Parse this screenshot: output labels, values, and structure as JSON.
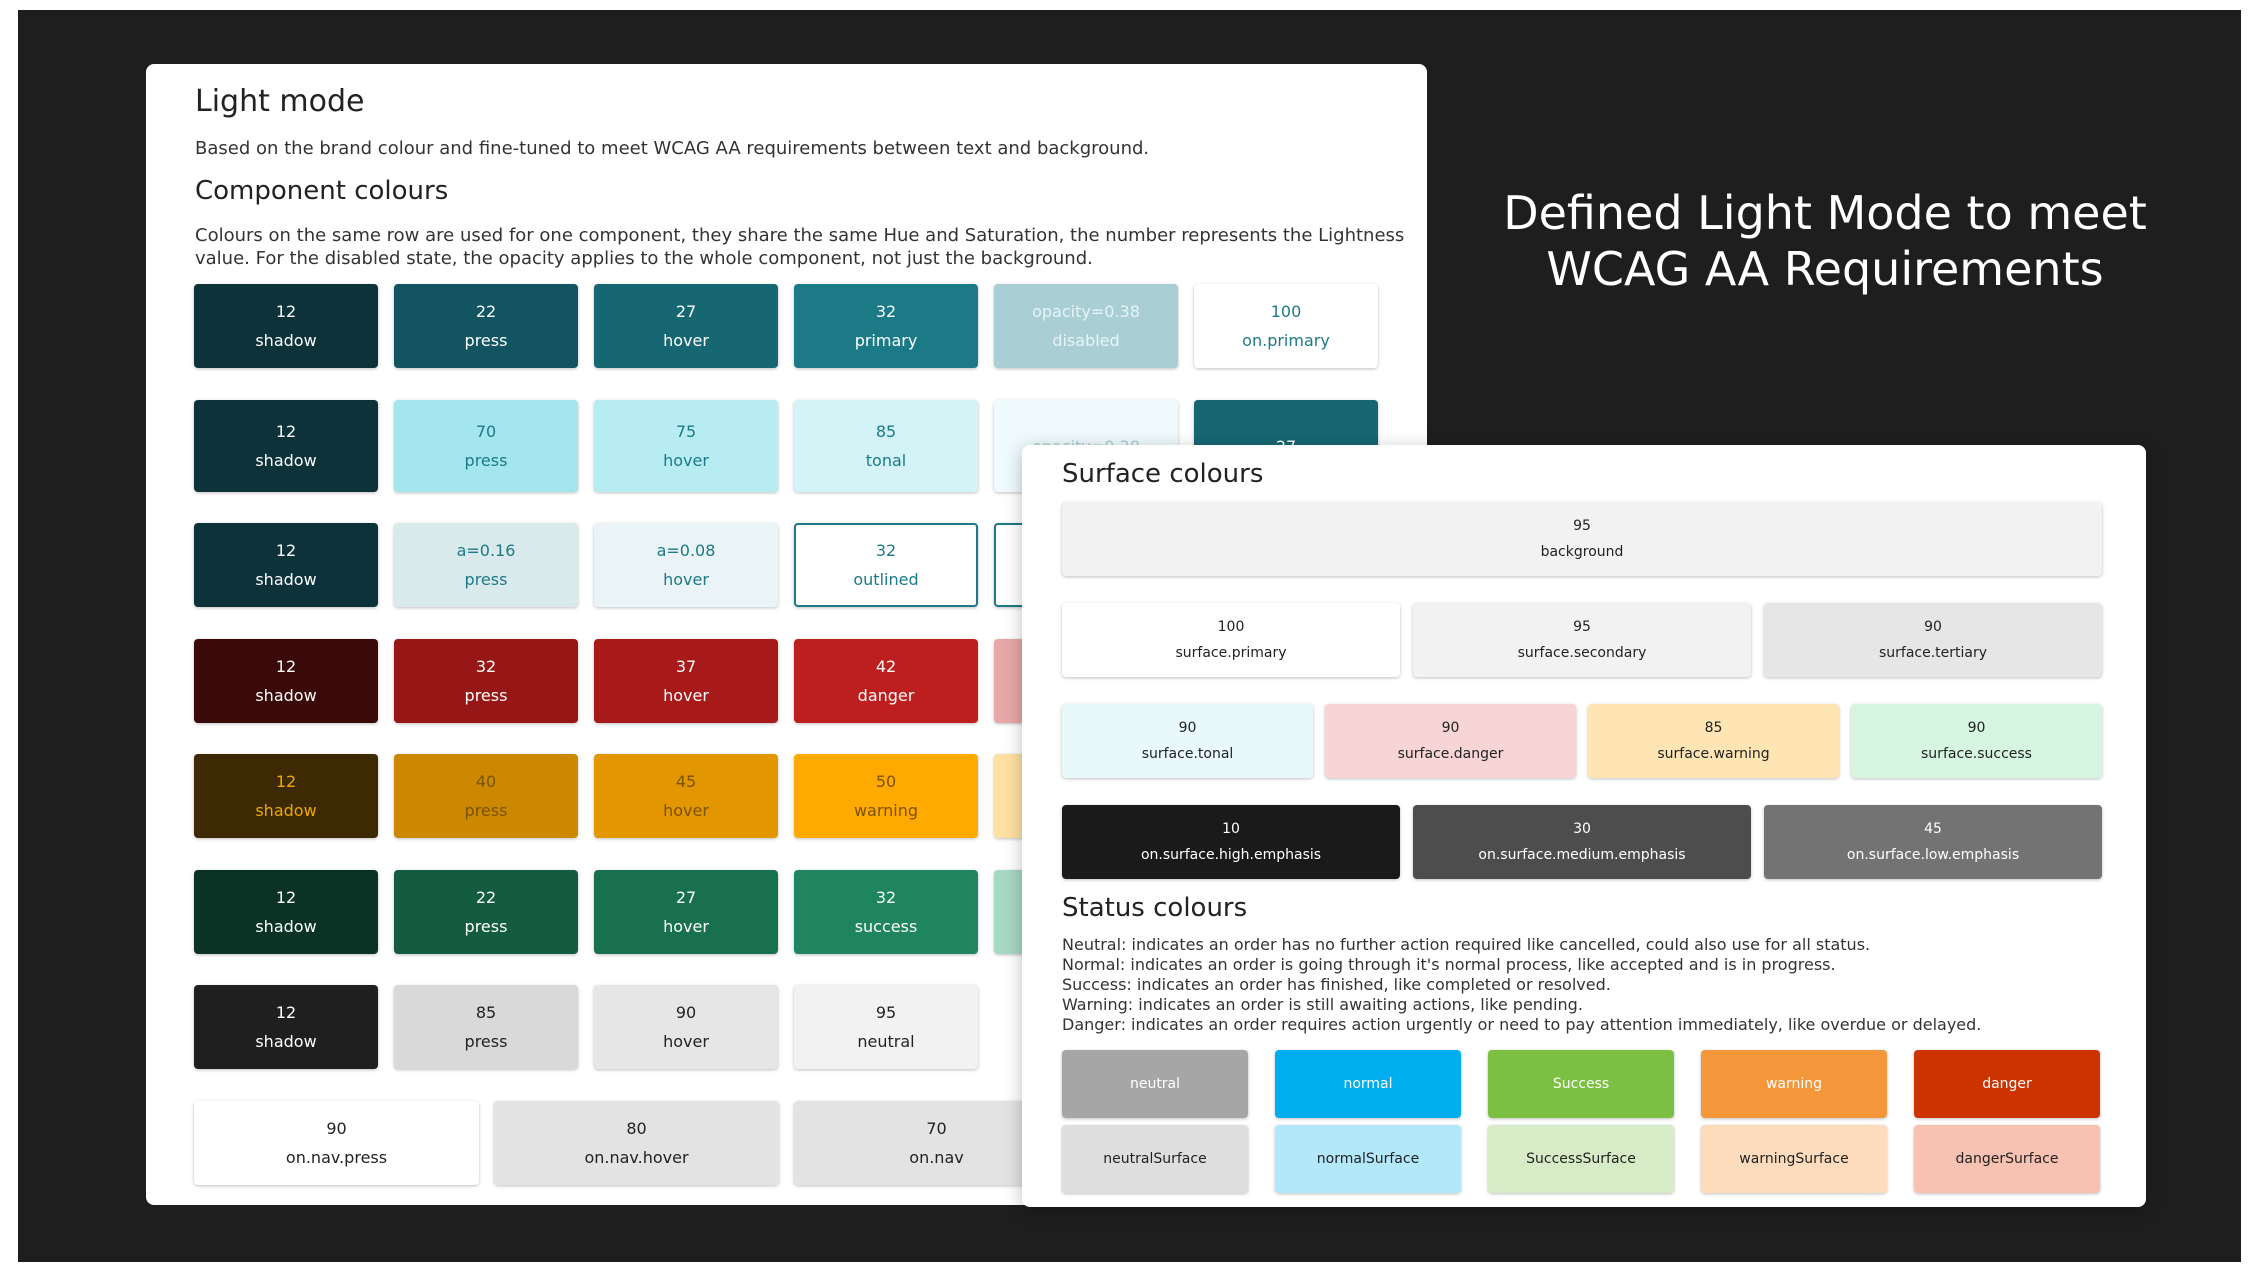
{
  "hero": {
    "line1": "Defined Light Mode to meet",
    "line2": "WCAG AA Requirements"
  },
  "light": {
    "title": "Light mode",
    "intro": "Based on the brand colour and fine-tuned to meet WCAG AA requirements between text and background.",
    "component_title": "Component colours",
    "component_desc_1": "Colours on the same row are used for one component, they share the same Hue and Saturation, the number represents the Lightness",
    "component_desc_2": "value. For the disabled state, the opacity applies to the whole component, not just the background.",
    "rows": [
      [
        {
          "n": "12",
          "l": "shadow",
          "bg": "#0d3239",
          "fg": "#ffffff"
        },
        {
          "n": "22",
          "l": "press",
          "bg": "#125560",
          "fg": "#ffffff"
        },
        {
          "n": "27",
          "l": "hover",
          "bg": "#176773",
          "fg": "#ffffff"
        },
        {
          "n": "32",
          "l": "primary",
          "bg": "#1c7a87",
          "fg": "#ffffff"
        },
        {
          "n": "opacity=0.38",
          "l": "disabled",
          "bg": "#a9cfd4",
          "fg": "#e6f4f6"
        },
        {
          "n": "100",
          "l": "on.primary",
          "bg": "#ffffff",
          "fg": "#1c7a87"
        }
      ],
      [
        {
          "n": "12",
          "l": "shadow",
          "bg": "#0d3239",
          "fg": "#ffffff"
        },
        {
          "n": "70",
          "l": "press",
          "bg": "#a3e6ee",
          "fg": "#1c7a87"
        },
        {
          "n": "75",
          "l": "hover",
          "bg": "#b7ecf2",
          "fg": "#1c7a87"
        },
        {
          "n": "85",
          "l": "tonal",
          "bg": "#d3f3f7",
          "fg": "#1c7a87"
        },
        {
          "n": "opacity=0.38",
          "l": "",
          "bg": "#eefafc",
          "fg": "#a9cfd4"
        },
        {
          "n": "27",
          "l": "",
          "bg": "#176773",
          "fg": "#ffffff"
        }
      ],
      [
        {
          "n": "12",
          "l": "shadow",
          "bg": "#0d3239",
          "fg": "#ffffff"
        },
        {
          "n": "a=0.16",
          "l": "press",
          "bg": "#dae9ec",
          "fg": "#1c7a87"
        },
        {
          "n": "a=0.08",
          "l": "hover",
          "bg": "#eaf3f5",
          "fg": "#1c7a87"
        },
        {
          "n": "32",
          "l": "outlined",
          "bg": "#ffffff",
          "fg": "#1c7a87"
        }
      ],
      [
        {
          "n": "12",
          "l": "shadow",
          "bg": "#3a0a0a",
          "fg": "#ffffff"
        },
        {
          "n": "32",
          "l": "press",
          "bg": "#971616",
          "fg": "#ffffff"
        },
        {
          "n": "37",
          "l": "hover",
          "bg": "#a81a1a",
          "fg": "#ffffff"
        },
        {
          "n": "42",
          "l": "danger",
          "bg": "#bd1f1f",
          "fg": "#ffffff"
        }
      ],
      [
        {
          "n": "12",
          "l": "shadow",
          "bg": "#3d2a04",
          "fg": "#f0a800"
        },
        {
          "n": "40",
          "l": "press",
          "bg": "#cc8800",
          "fg": "#7a5200"
        },
        {
          "n": "45",
          "l": "hover",
          "bg": "#e29600",
          "fg": "#7a5200"
        },
        {
          "n": "50",
          "l": "warning",
          "bg": "#ffaa00",
          "fg": "#7a5200"
        }
      ],
      [
        {
          "n": "12",
          "l": "shadow",
          "bg": "#0b3325",
          "fg": "#ffffff"
        },
        {
          "n": "22",
          "l": "press",
          "bg": "#145c40",
          "fg": "#ffffff"
        },
        {
          "n": "27",
          "l": "hover",
          "bg": "#19704f",
          "fg": "#ffffff"
        },
        {
          "n": "32",
          "l": "success",
          "bg": "#1e855e",
          "fg": "#ffffff"
        }
      ],
      [
        {
          "n": "12",
          "l": "shadow",
          "bg": "#1f1f1f",
          "fg": "#ffffff"
        },
        {
          "n": "85",
          "l": "press",
          "bg": "#d9d9d9",
          "fg": "#222222"
        },
        {
          "n": "90",
          "l": "hover",
          "bg": "#e6e6e6",
          "fg": "#222222"
        },
        {
          "n": "95",
          "l": "neutral",
          "bg": "#f2f2f2",
          "fg": "#222222"
        }
      ]
    ],
    "nav_row": [
      {
        "n": "90",
        "l": "on.nav.press",
        "bg": "#ffffff",
        "fg": "#222222"
      },
      {
        "n": "80",
        "l": "on.nav.hover",
        "bg": "#e3e3e3",
        "fg": "#222222"
      },
      {
        "n": "70",
        "l": "on.nav",
        "bg": "#e3e3e3",
        "fg": "#222222"
      }
    ],
    "peek_colors": [
      "#e7a7a7",
      "#ffe0a3",
      "#a7d8c4"
    ]
  },
  "surface": {
    "title": "Surface colours",
    "background": {
      "n": "95",
      "l": "background",
      "bg": "#f2f2f2",
      "fg": "#222222"
    },
    "row1": [
      {
        "n": "100",
        "l": "surface.primary",
        "bg": "#ffffff",
        "fg": "#222222"
      },
      {
        "n": "95",
        "l": "surface.secondary",
        "bg": "#f2f2f2",
        "fg": "#222222"
      },
      {
        "n": "90",
        "l": "surface.tertiary",
        "bg": "#e6e6e6",
        "fg": "#222222"
      }
    ],
    "row2": [
      {
        "n": "90",
        "l": "surface.tonal",
        "bg": "#e9f9fb",
        "fg": "#222222"
      },
      {
        "n": "90",
        "l": "surface.danger",
        "bg": "#f7d5d5",
        "fg": "#222222"
      },
      {
        "n": "85",
        "l": "surface.warning",
        "bg": "#ffe5b3",
        "fg": "#222222"
      },
      {
        "n": "90",
        "l": "surface.success",
        "bg": "#d6f5df",
        "fg": "#222222"
      }
    ],
    "row3": [
      {
        "n": "10",
        "l": "on.surface.high.emphasis",
        "bg": "#1a1a1a",
        "fg": "#ffffff"
      },
      {
        "n": "30",
        "l": "on.surface.medium.emphasis",
        "bg": "#4d4d4d",
        "fg": "#ffffff"
      },
      {
        "n": "45",
        "l": "on.surface.low.emphasis",
        "bg": "#737373",
        "fg": "#ffffff"
      }
    ],
    "status_title": "Status colours",
    "status_lines": [
      "Neutral: indicates an order has no further action required like cancelled, could also use for all status.",
      "Normal: indicates an order is going through it's normal process, like accepted and is in progress.",
      "Success: indicates an order has finished, like completed or resolved.",
      "Warning: indicates an order is still awaiting actions, like pending.",
      "Danger: indicates an order requires action urgently or need to pay attention immediately, like overdue or delayed."
    ],
    "status_main": [
      {
        "l": "neutral",
        "bg": "#a6a6a6",
        "fg": "#ffffff"
      },
      {
        "l": "normal",
        "bg": "#00aeef",
        "fg": "#ffffff"
      },
      {
        "l": "Success",
        "bg": "#7bc043",
        "fg": "#ffffff"
      },
      {
        "l": "warning",
        "bg": "#f4963a",
        "fg": "#ffffff"
      },
      {
        "l": "danger",
        "bg": "#cc3300",
        "fg": "#ffffff"
      }
    ],
    "status_surface": [
      {
        "l": "neutralSurface",
        "bg": "#dedede",
        "fg": "#222222"
      },
      {
        "l": "normalSurface",
        "bg": "#b3e7fa",
        "fg": "#222222"
      },
      {
        "l": "SuccessSurface",
        "bg": "#d7ecc6",
        "fg": "#222222"
      },
      {
        "l": "warningSurface",
        "bg": "#fcdcbc",
        "fg": "#222222"
      },
      {
        "l": "dangerSurface",
        "bg": "#f8c2b3",
        "fg": "#222222"
      }
    ]
  }
}
